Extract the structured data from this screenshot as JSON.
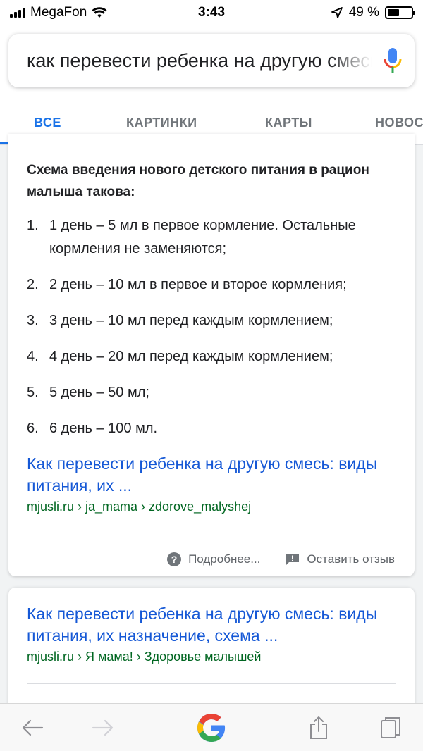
{
  "status_bar": {
    "carrier": "MegaFon",
    "time": "3:43",
    "battery_percent": "49 %",
    "battery_level": 0.49
  },
  "search": {
    "query": "как перевести ребенка на другую смесь"
  },
  "tabs": [
    {
      "label": "ВСЕ",
      "active": true
    },
    {
      "label": "КАРТИНКИ",
      "active": false
    },
    {
      "label": "КАРТЫ",
      "active": false
    },
    {
      "label": "НОВОСТИ",
      "active": false
    }
  ],
  "snippet": {
    "heading": "Схема введения нового детского питания в рацион малыша такова:",
    "items": [
      {
        "num": "1.",
        "text": "1 день – 5 мл в первое кормление. Остальные кормления не заменяются;"
      },
      {
        "num": "2.",
        "text": "2 день – 10 мл в первое и второе кормления;"
      },
      {
        "num": "3.",
        "text": "3 день – 10 мл перед каждым кормлением;"
      },
      {
        "num": "4.",
        "text": "4 день – 20 мл перед каждым кормлением;"
      },
      {
        "num": "5.",
        "text": "5 день – 50 мл;"
      },
      {
        "num": "6.",
        "text": "6 день – 100 мл."
      }
    ],
    "result_title": "Как перевести ребенка на другую смесь: виды питания, их ...",
    "result_url": "mjusli.ru › ja_mama › zdorove_malyshej",
    "more_label": "Подробнее...",
    "feedback_label": "Оставить отзыв"
  },
  "result2": {
    "title": "Как перевести ребенка на другую смесь: виды питания, их назначение, схема ...",
    "url": "mjusli.ru › Я мама! › Здоровье малышей"
  },
  "colors": {
    "accent": "#1a73e8",
    "link": "#1558d6",
    "url": "#006621"
  }
}
